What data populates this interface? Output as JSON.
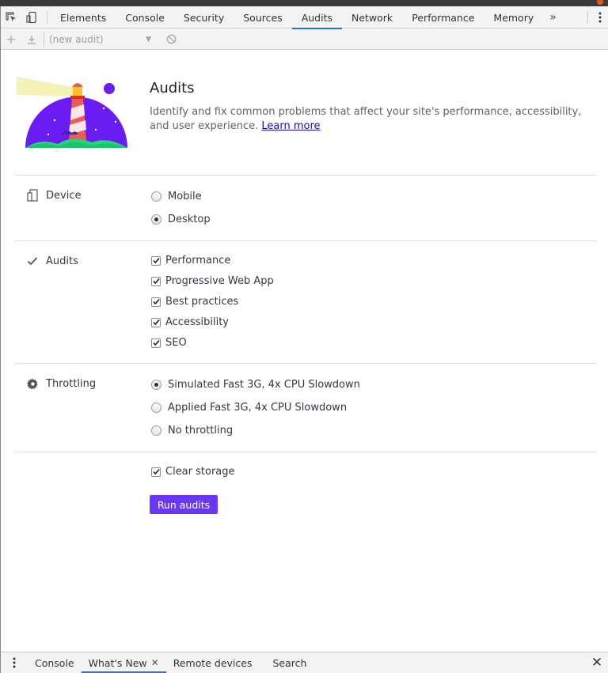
{
  "tabs": [
    {
      "label": "Elements",
      "active": false
    },
    {
      "label": "Console",
      "active": false
    },
    {
      "label": "Security",
      "active": false
    },
    {
      "label": "Sources",
      "active": false
    },
    {
      "label": "Audits",
      "active": true
    },
    {
      "label": "Network",
      "active": false
    },
    {
      "label": "Performance",
      "active": false
    },
    {
      "label": "Memory",
      "active": false
    }
  ],
  "toolbar": {
    "audit_select": "(new audit)"
  },
  "hero": {
    "title": "Audits",
    "description": "Identify and fix common problems that affect your site's performance, accessibility, and user experience.",
    "learn_more": "Learn more"
  },
  "device": {
    "label": "Device",
    "options": [
      {
        "label": "Mobile",
        "checked": false
      },
      {
        "label": "Desktop",
        "checked": true
      }
    ]
  },
  "audits": {
    "label": "Audits",
    "options": [
      {
        "label": "Performance",
        "checked": true
      },
      {
        "label": "Progressive Web App",
        "checked": true
      },
      {
        "label": "Best practices",
        "checked": true
      },
      {
        "label": "Accessibility",
        "checked": true
      },
      {
        "label": "SEO",
        "checked": true
      }
    ]
  },
  "throttling": {
    "label": "Throttling",
    "options": [
      {
        "label": "Simulated Fast 3G, 4x CPU Slowdown",
        "checked": true
      },
      {
        "label": "Applied Fast 3G, 4x CPU Slowdown",
        "checked": false
      },
      {
        "label": "No throttling",
        "checked": false
      }
    ]
  },
  "clear_storage": {
    "label": "Clear storage",
    "checked": true
  },
  "run_button": "Run audits",
  "drawer": {
    "tabs": [
      {
        "label": "Console",
        "active": false,
        "closable": false
      },
      {
        "label": "What's New",
        "active": true,
        "closable": true
      },
      {
        "label": "Remote devices",
        "active": false,
        "closable": false
      },
      {
        "label": "Search",
        "active": false,
        "closable": false
      }
    ]
  },
  "colors": {
    "accent": "#1a73e8",
    "run_button": "#6b37f7",
    "logo_purple": "#6a1cf2"
  }
}
